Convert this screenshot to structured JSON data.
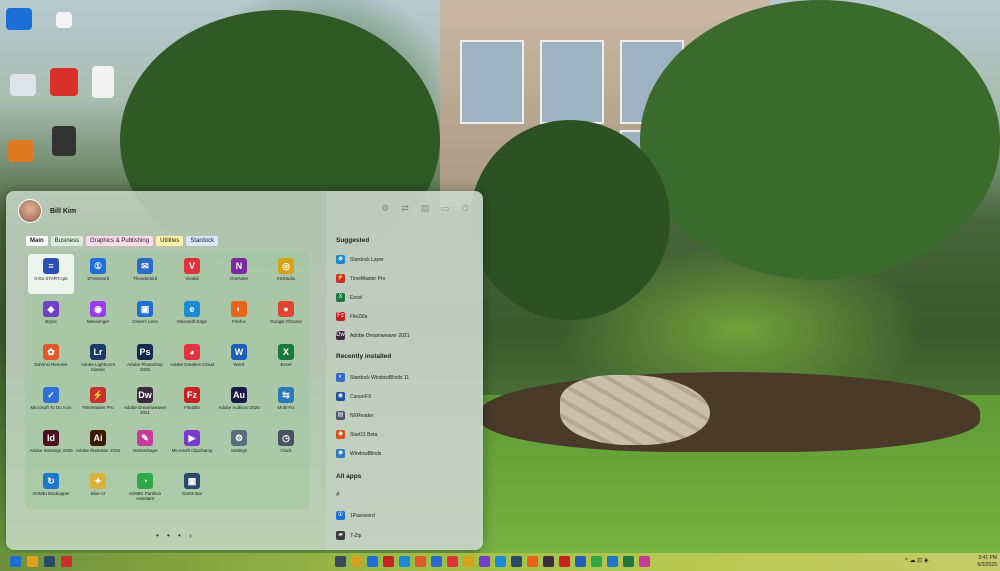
{
  "start_menu": {
    "user_name": "Bill Kim",
    "tabs": [
      {
        "label": "Main"
      },
      {
        "label": "Business"
      },
      {
        "label": "Graphics & Publishing"
      },
      {
        "label": "Utilities"
      },
      {
        "label": "Stardock"
      }
    ],
    "apps": [
      {
        "label": "0-Do START.cpb",
        "color": "#2b4fb3",
        "glyph": "≡"
      },
      {
        "label": "1Password",
        "color": "#1b6fd6",
        "glyph": "①"
      },
      {
        "label": "Thunderbird",
        "color": "#2a6acb",
        "glyph": "✉"
      },
      {
        "label": "Vivaldi",
        "color": "#e0323c",
        "glyph": "V"
      },
      {
        "label": "OneNote",
        "color": "#7a2a9e",
        "glyph": "N"
      },
      {
        "label": "VSStudio",
        "color": "#d6a316",
        "glyph": "◎"
      },
      {
        "label": "Bryce",
        "color": "#7040c8",
        "glyph": "◆"
      },
      {
        "label": "Messenger",
        "color": "#9a3cf0",
        "glyph": "◉"
      },
      {
        "label": "Cheers Lens",
        "color": "#1f6fd1",
        "glyph": "▣"
      },
      {
        "label": "Microsoft Edge",
        "color": "#1b8bd3",
        "glyph": "e"
      },
      {
        "label": "Firefox",
        "color": "#e8641b",
        "glyph": "◐"
      },
      {
        "label": "Google Chrome",
        "color": "#df4533",
        "glyph": "●"
      },
      {
        "label": "DaVinci Resolve",
        "color": "#e0572a",
        "glyph": "✿"
      },
      {
        "label": "Adobe Lightroom Classic",
        "color": "#1c3a66",
        "glyph": "Lr"
      },
      {
        "label": "Adobe Photoshop 2025",
        "color": "#0f2a4d",
        "glyph": "Ps"
      },
      {
        "label": "Adobe Creative Cloud",
        "color": "#e0343e",
        "glyph": "◕"
      },
      {
        "label": "Word",
        "color": "#1f5fb8",
        "glyph": "W"
      },
      {
        "label": "Excel",
        "color": "#1d7a3f",
        "glyph": "X"
      },
      {
        "label": "Microsoft To Do Icon",
        "color": "#2e6fd8",
        "glyph": "✓"
      },
      {
        "label": "TimeMaster Pro",
        "color": "#c9302c",
        "glyph": "⚡"
      },
      {
        "label": "Adobe Dreamweaver 2021",
        "color": "#3b2a40",
        "glyph": "Dw"
      },
      {
        "label": "FileZilla",
        "color": "#c72222",
        "glyph": "Fz"
      },
      {
        "label": "Adobe Audition 2025",
        "color": "#1a1a4a",
        "glyph": "Au"
      },
      {
        "label": "Multi-Fix",
        "color": "#2a7ab8",
        "glyph": "⇆"
      },
      {
        "label": "Adobe InDesign 2025",
        "color": "#4a1020",
        "glyph": "Id"
      },
      {
        "label": "Adobe Illustrator 2025",
        "color": "#3a1a00",
        "glyph": "Ai"
      },
      {
        "label": "Vectorshape",
        "color": "#c83a9a",
        "glyph": "✎"
      },
      {
        "label": "Microsoft Clipchamp",
        "color": "#7a3ad0",
        "glyph": "▶"
      },
      {
        "label": "Settings",
        "color": "#5a6d80",
        "glyph": "⚙"
      },
      {
        "label": "Clock",
        "color": "#4a5260",
        "glyph": "◷"
      },
      {
        "label": "AOMEI Backupper",
        "color": "#1e78c8",
        "glyph": "↻"
      },
      {
        "label": "Blue AI",
        "color": "#d8b23a",
        "glyph": "✦"
      },
      {
        "label": "AOMEI Partition Assistant",
        "color": "#2fa84a",
        "glyph": "◔"
      },
      {
        "label": "Game Bar",
        "color": "#2a4a6a",
        "glyph": "▦"
      }
    ],
    "page_dots": "• • • ›",
    "suggested_title": "Suggested",
    "suggested": [
      {
        "label": "Stardock Layer",
        "color": "#1a8ad3",
        "glyph": "◆"
      },
      {
        "label": "TimeMaster Pro",
        "color": "#c9302c",
        "glyph": "⚡"
      },
      {
        "label": "Excel",
        "color": "#1d7a3f",
        "glyph": "X"
      },
      {
        "label": "FileZilla",
        "color": "#c72222",
        "glyph": "Fz"
      },
      {
        "label": "Adobe Dreamweaver 2021",
        "color": "#3b2a40",
        "glyph": "Dw"
      }
    ],
    "recent_title": "Recently installed",
    "recent": [
      {
        "label": "Stardock WindowBlinds 11",
        "color": "#3a6ac8",
        "glyph": "◐"
      },
      {
        "label": "CursorFX",
        "color": "#1a4fa8",
        "glyph": "◉"
      },
      {
        "label": "NXReader",
        "color": "#4a5a6a",
        "glyph": "▤"
      },
      {
        "label": "Start11 Beta",
        "color": "#d9541a",
        "glyph": "◆"
      },
      {
        "label": "WindowBlinds",
        "color": "#2a7ac8",
        "glyph": "◆"
      }
    ],
    "all_apps_title": "All apps",
    "all_apps_letter": "#",
    "all_apps": [
      {
        "label": "1Password",
        "color": "#1b6fd6",
        "glyph": "①"
      },
      {
        "label": "7-Zip",
        "color": "#3a3a3a",
        "glyph": "▰"
      }
    ]
  },
  "taskbar": {
    "icons": [
      {
        "name": "start-icon",
        "color": "#1b6fd6"
      },
      {
        "name": "pin-icon",
        "color": "#e0a020"
      },
      {
        "name": "monitor-icon",
        "color": "#2a4a6a"
      },
      {
        "name": "apps-icon",
        "color": "#c9302c"
      },
      {
        "name": "app-1-icon",
        "color": "#3a4a5a"
      },
      {
        "name": "app-2-icon",
        "color": "#d8a020"
      },
      {
        "name": "app-3-icon",
        "color": "#1b6fd6"
      },
      {
        "name": "app-4-icon",
        "color": "#c72222"
      },
      {
        "name": "app-5-icon",
        "color": "#1a8ad3"
      },
      {
        "name": "app-6-icon",
        "color": "#e0572a"
      },
      {
        "name": "app-7-icon",
        "color": "#2a6acb"
      },
      {
        "name": "app-8-icon",
        "color": "#e0323c"
      },
      {
        "name": "app-9-icon",
        "color": "#d6a316"
      },
      {
        "name": "app-10-icon",
        "color": "#7040c8"
      },
      {
        "name": "app-11-icon",
        "color": "#1b8bd3"
      },
      {
        "name": "app-12-icon",
        "color": "#2a4a6a"
      },
      {
        "name": "app-13-icon",
        "color": "#e8641b"
      },
      {
        "name": "app-14-icon",
        "color": "#3b2a40"
      },
      {
        "name": "app-15-icon",
        "color": "#c72222"
      },
      {
        "name": "app-16-icon",
        "color": "#1f5fb8"
      },
      {
        "name": "app-17-icon",
        "color": "#2fa84a"
      },
      {
        "name": "app-18-icon",
        "color": "#1e78c8"
      },
      {
        "name": "app-19-icon",
        "color": "#1d7a3f"
      },
      {
        "name": "app-20-icon",
        "color": "#c83a9a"
      }
    ],
    "tray_text": "^ ☁ ⊡ ◈",
    "clock_time": "3:41 PM",
    "clock_date": "6/3/2025"
  }
}
